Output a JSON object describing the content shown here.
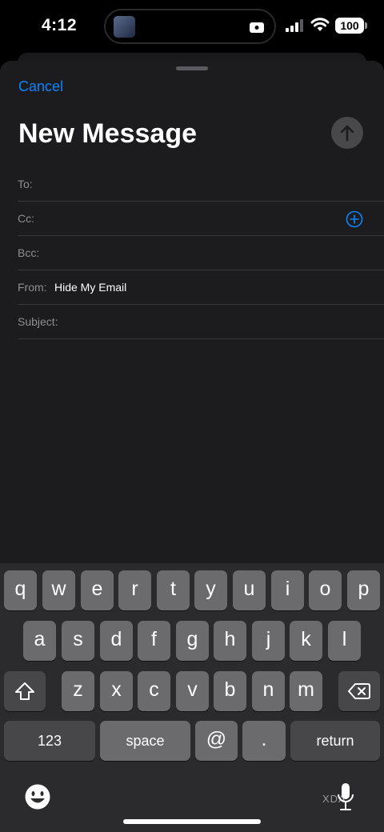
{
  "status": {
    "time": "4:12",
    "battery": "100"
  },
  "compose": {
    "cancel": "Cancel",
    "title": "New Message",
    "fields": {
      "to_label": "To:",
      "cc_label": "Cc:",
      "bcc_label": "Bcc:",
      "from_label": "From:",
      "from_value": "Hide My Email",
      "subject_label": "Subject:"
    }
  },
  "keyboard": {
    "row1": [
      "q",
      "w",
      "e",
      "r",
      "t",
      "y",
      "u",
      "i",
      "o",
      "p"
    ],
    "row2": [
      "a",
      "s",
      "d",
      "f",
      "g",
      "h",
      "j",
      "k",
      "l"
    ],
    "row3": [
      "z",
      "x",
      "c",
      "v",
      "b",
      "n",
      "m"
    ],
    "numbers": "123",
    "space": "space",
    "at": "@",
    "dot": ".",
    "return": "return"
  },
  "watermark": "XDA",
  "colors": {
    "accent": "#0a84ff",
    "sheet": "#1c1c1e",
    "key": "#6b6b6e",
    "key_dark": "#474749"
  }
}
